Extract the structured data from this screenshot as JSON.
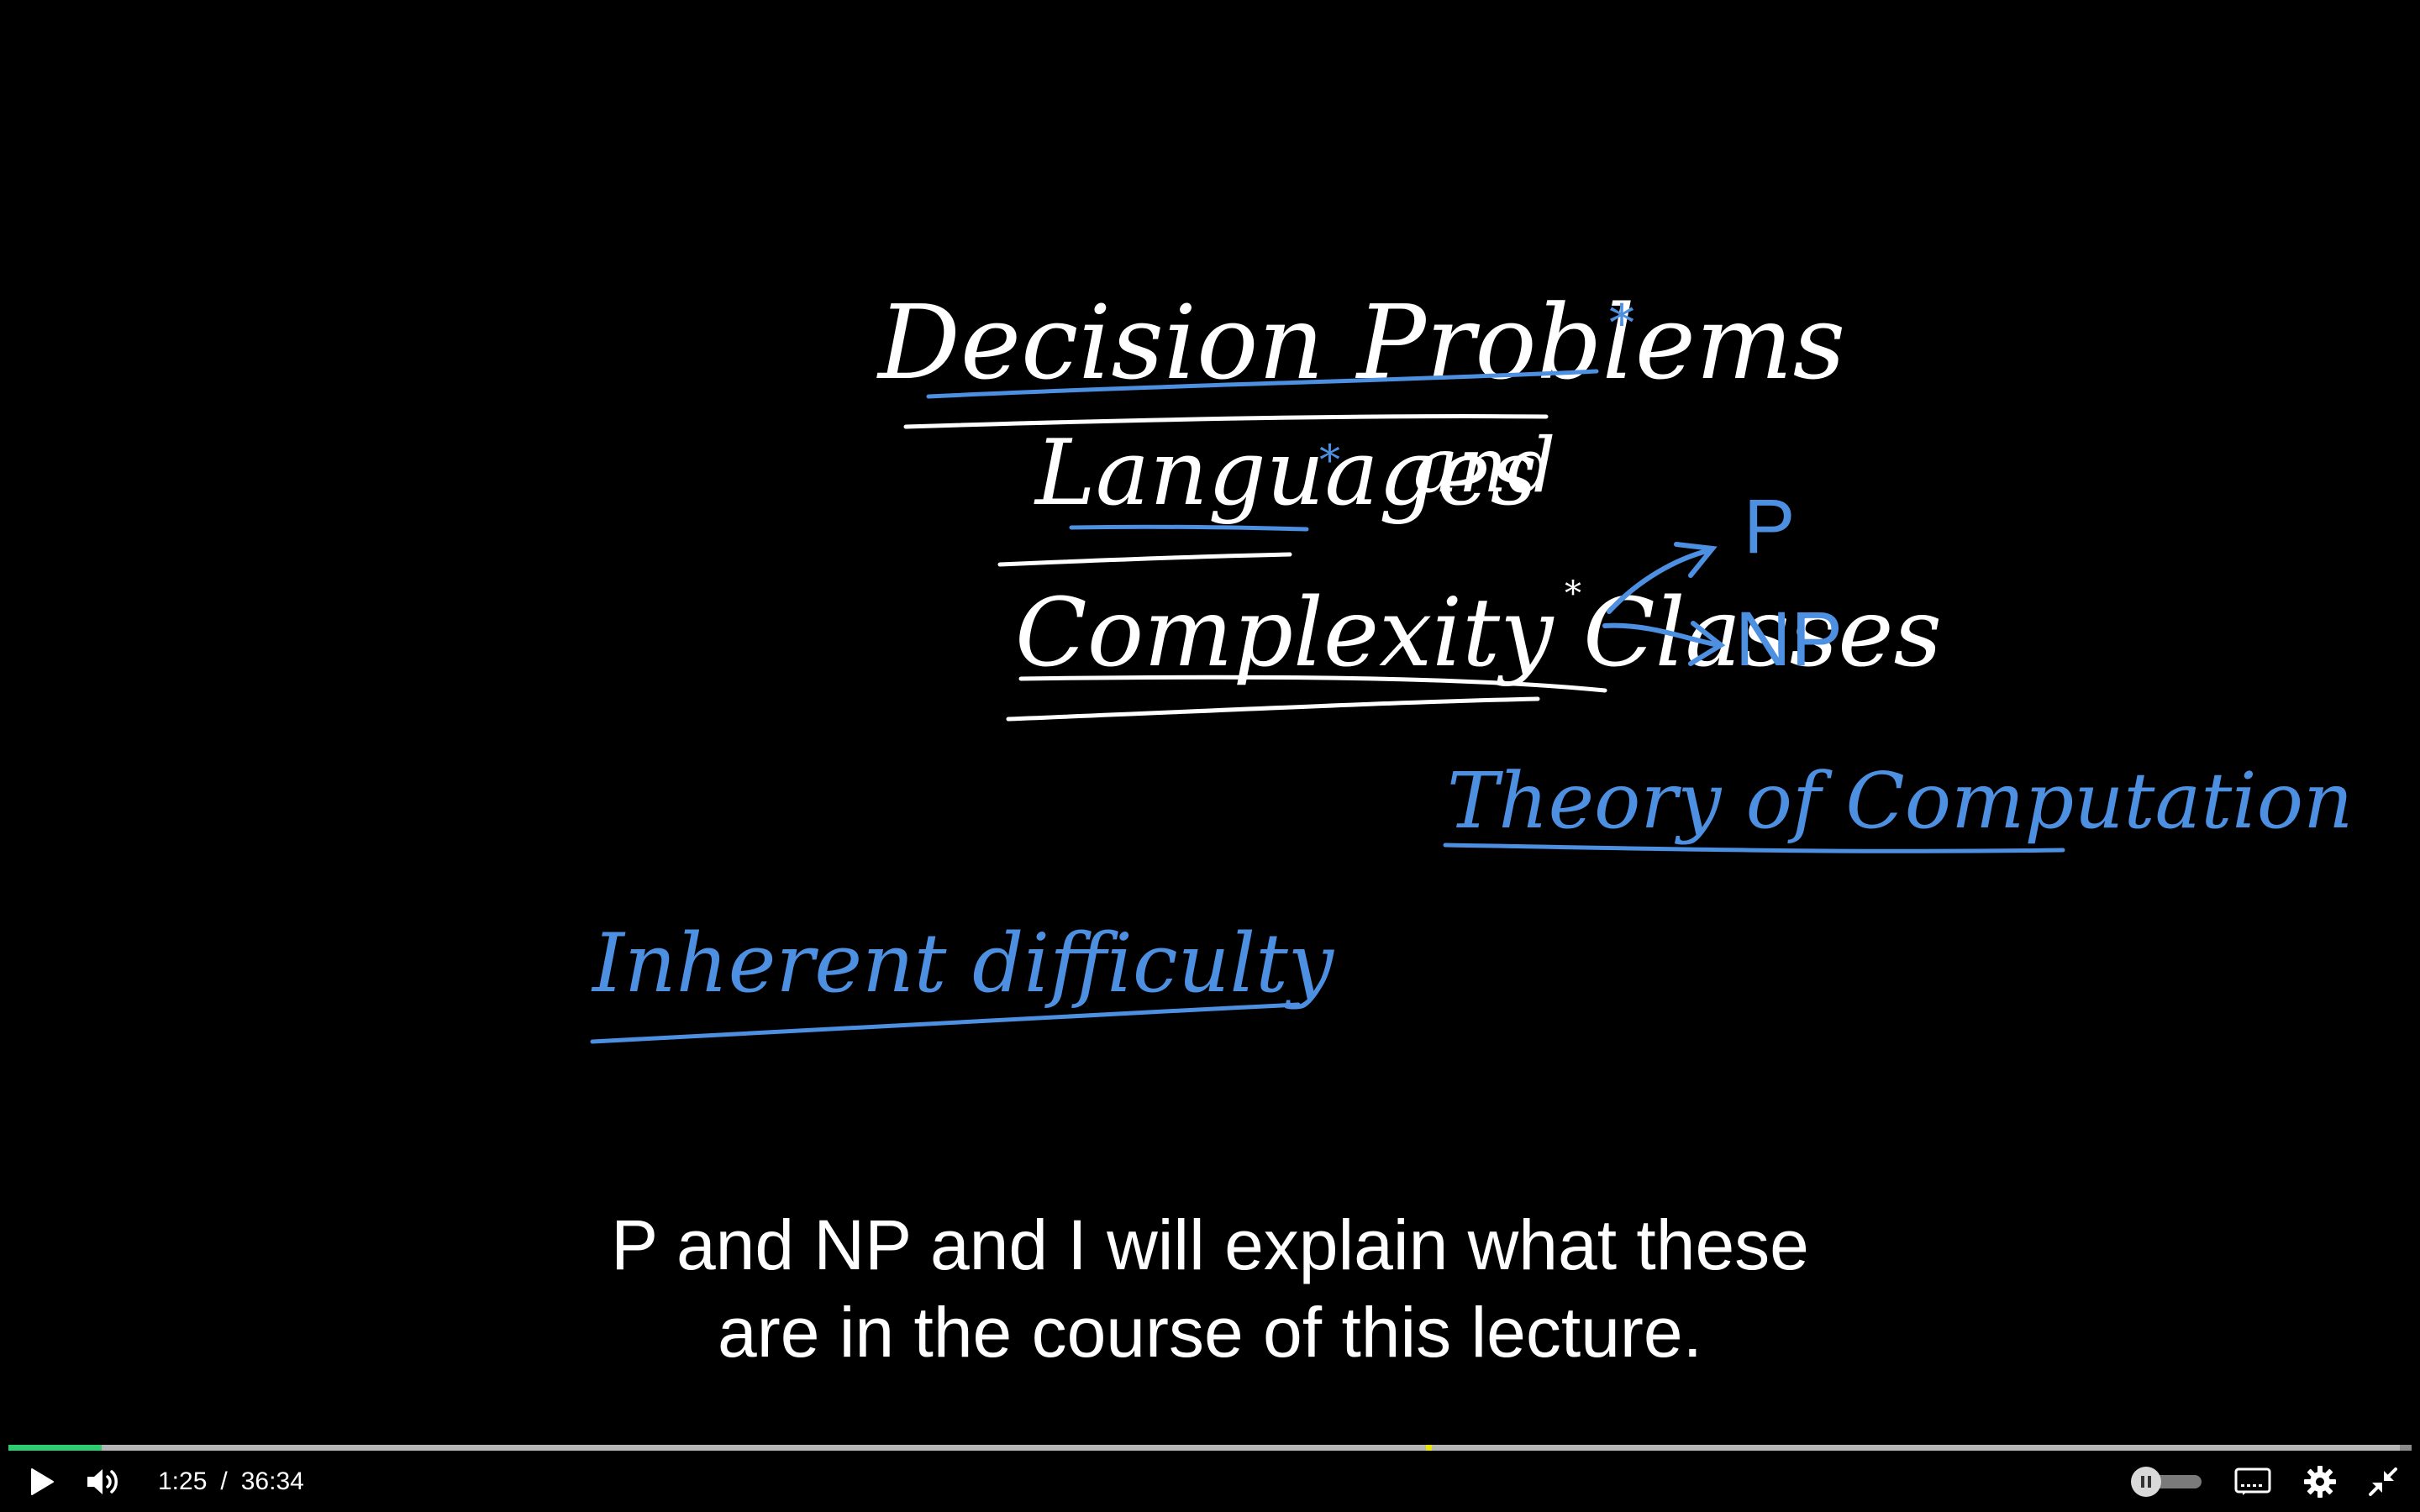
{
  "board": {
    "line1": "Decision Problems",
    "line2_a": "Languages",
    "line2_b": "and",
    "line3": "Complexity Classes",
    "class_p": "P",
    "class_np": "NP",
    "topic": "Theory of Computation",
    "note": "Inherent difficulty",
    "asterisk": "*"
  },
  "captions": {
    "line1": "P and NP and I will explain what these",
    "line2": "are in the course of this lecture."
  },
  "player": {
    "current_time": "1:25",
    "separator": "/",
    "duration": "36:34",
    "played_fraction": 0.0388,
    "buffered_fraction": 0.995,
    "chapter_marker_fraction": 0.59,
    "autoplay_on": false
  },
  "colors": {
    "chalk_white": "#ffffff",
    "chalk_blue": "#4d8fe0",
    "progress_played": "#2ecc71",
    "chapter_marker": "#e6e600"
  },
  "icons": {
    "play": "play-icon",
    "volume": "volume-icon",
    "autoplay": "autoplay-toggle-icon",
    "captions": "captions-icon",
    "settings": "gear-icon",
    "exit_fullscreen": "exit-fullscreen-icon"
  }
}
